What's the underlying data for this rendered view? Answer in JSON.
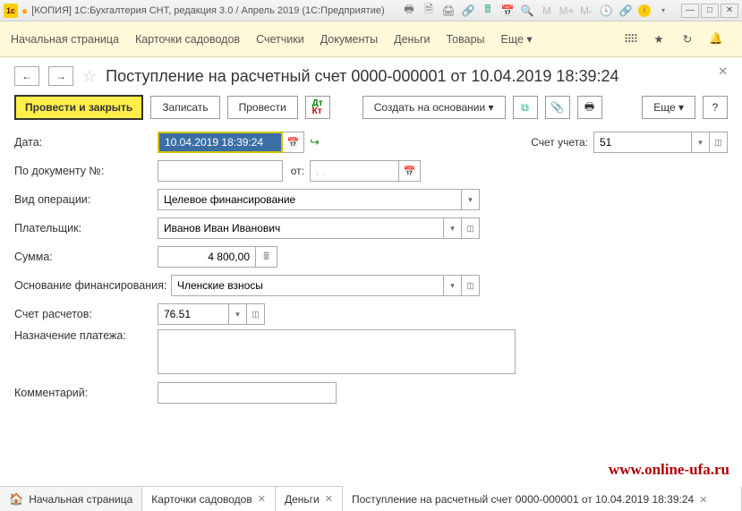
{
  "titlebar": {
    "text": "[КОПИЯ] 1С:Бухгалтерия СНТ, редакция 3.0 / Апрель 2019  (1С:Предприятие)"
  },
  "mainmenu": {
    "items": [
      "Начальная страница",
      "Карточки садоводов",
      "Счетчики",
      "Документы",
      "Деньги",
      "Товары"
    ],
    "more": "Еще ▾"
  },
  "doc": {
    "title": "Поступление на расчетный счет 0000-000001 от 10.04.2019 18:39:24"
  },
  "toolbar": {
    "post_close": "Провести и закрыть",
    "save": "Записать",
    "post": "Провести",
    "create_based": "Создать на основании ▾",
    "more": "Еще ▾",
    "help": "?"
  },
  "form": {
    "date_label": "Дата:",
    "date_value": "10.04.2019 18:39:24",
    "account_label": "Счет учета:",
    "account_value": "51",
    "docnum_label": "По документу №:",
    "docnum_value": "",
    "from_label": "от:",
    "from_value": ". .",
    "optype_label": "Вид операции:",
    "optype_value": "Целевое финансирование",
    "payer_label": "Плательщик:",
    "payer_value": "Иванов Иван Иванович",
    "sum_label": "Сумма:",
    "sum_value": "4 800,00",
    "basis_label": "Основание финансирования:",
    "basis_value": "Членские взносы",
    "settle_label": "Счет расчетов:",
    "settle_value": "76.51",
    "purpose_label": "Назначение платежа:",
    "purpose_value": "",
    "comment_label": "Комментарий:",
    "comment_value": ""
  },
  "tabs": {
    "home": "Начальная страница",
    "t1": "Карточки садоводов",
    "t2": "Деньги",
    "t3": "Поступление на расчетный счет 0000-000001 от 10.04.2019 18:39:24"
  },
  "watermark": "www.online-ufa.ru"
}
